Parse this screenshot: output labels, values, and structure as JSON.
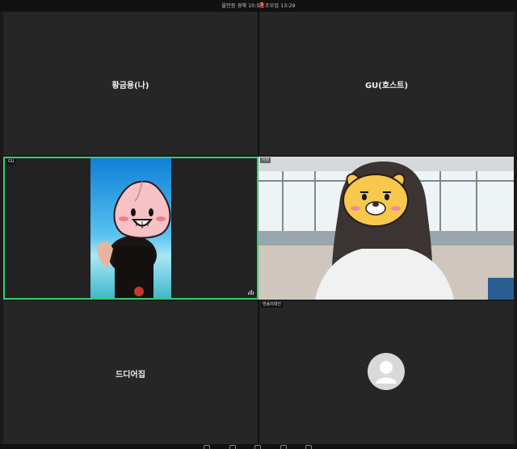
{
  "window": {
    "title": "울만믐 경해 10:5 - 조모임 13:29",
    "rec_badge": "3"
  },
  "participants": [
    {
      "name": "황금용(나)"
    },
    {
      "name": "GU(호스트)"
    },
    {
      "tag": "GU"
    },
    {
      "tag": "이현"
    },
    {
      "name": "드디어집"
    },
    {
      "tag": "방송의대인"
    }
  ],
  "colors": {
    "active_speaker_border": "#2fcf74",
    "tile_bg": "#262626",
    "background": "#1a1a1a"
  }
}
